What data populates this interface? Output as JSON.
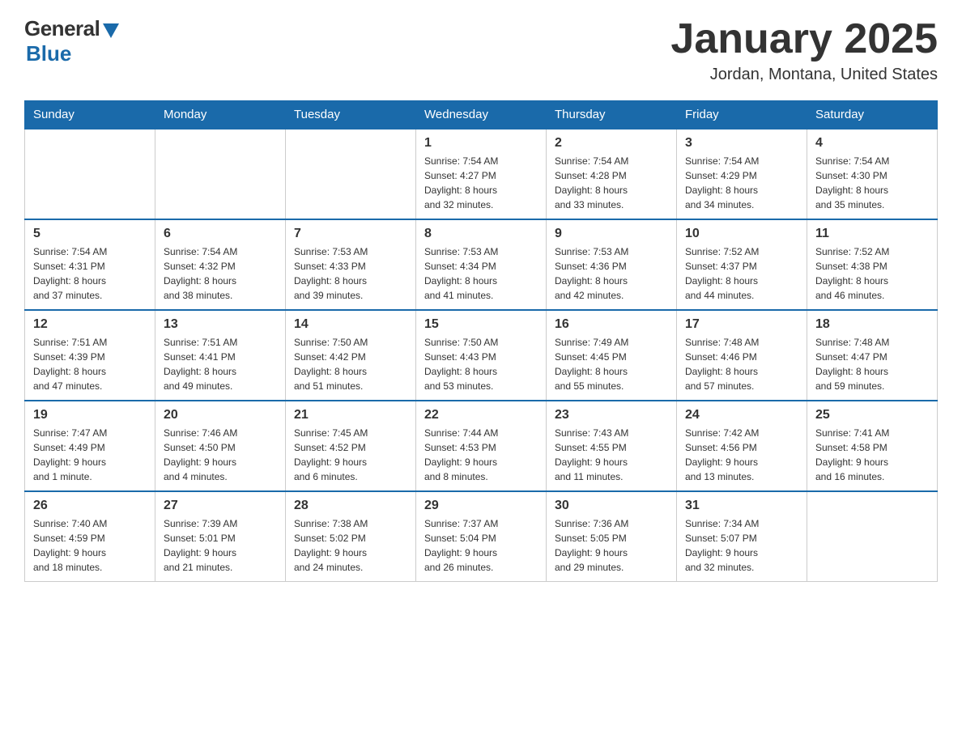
{
  "header": {
    "logo_general": "General",
    "logo_blue": "Blue",
    "title": "January 2025",
    "subtitle": "Jordan, Montana, United States"
  },
  "days_of_week": [
    "Sunday",
    "Monday",
    "Tuesday",
    "Wednesday",
    "Thursday",
    "Friday",
    "Saturday"
  ],
  "weeks": [
    {
      "days": [
        {
          "number": "",
          "info": ""
        },
        {
          "number": "",
          "info": ""
        },
        {
          "number": "",
          "info": ""
        },
        {
          "number": "1",
          "info": "Sunrise: 7:54 AM\nSunset: 4:27 PM\nDaylight: 8 hours\nand 32 minutes."
        },
        {
          "number": "2",
          "info": "Sunrise: 7:54 AM\nSunset: 4:28 PM\nDaylight: 8 hours\nand 33 minutes."
        },
        {
          "number": "3",
          "info": "Sunrise: 7:54 AM\nSunset: 4:29 PM\nDaylight: 8 hours\nand 34 minutes."
        },
        {
          "number": "4",
          "info": "Sunrise: 7:54 AM\nSunset: 4:30 PM\nDaylight: 8 hours\nand 35 minutes."
        }
      ]
    },
    {
      "days": [
        {
          "number": "5",
          "info": "Sunrise: 7:54 AM\nSunset: 4:31 PM\nDaylight: 8 hours\nand 37 minutes."
        },
        {
          "number": "6",
          "info": "Sunrise: 7:54 AM\nSunset: 4:32 PM\nDaylight: 8 hours\nand 38 minutes."
        },
        {
          "number": "7",
          "info": "Sunrise: 7:53 AM\nSunset: 4:33 PM\nDaylight: 8 hours\nand 39 minutes."
        },
        {
          "number": "8",
          "info": "Sunrise: 7:53 AM\nSunset: 4:34 PM\nDaylight: 8 hours\nand 41 minutes."
        },
        {
          "number": "9",
          "info": "Sunrise: 7:53 AM\nSunset: 4:36 PM\nDaylight: 8 hours\nand 42 minutes."
        },
        {
          "number": "10",
          "info": "Sunrise: 7:52 AM\nSunset: 4:37 PM\nDaylight: 8 hours\nand 44 minutes."
        },
        {
          "number": "11",
          "info": "Sunrise: 7:52 AM\nSunset: 4:38 PM\nDaylight: 8 hours\nand 46 minutes."
        }
      ]
    },
    {
      "days": [
        {
          "number": "12",
          "info": "Sunrise: 7:51 AM\nSunset: 4:39 PM\nDaylight: 8 hours\nand 47 minutes."
        },
        {
          "number": "13",
          "info": "Sunrise: 7:51 AM\nSunset: 4:41 PM\nDaylight: 8 hours\nand 49 minutes."
        },
        {
          "number": "14",
          "info": "Sunrise: 7:50 AM\nSunset: 4:42 PM\nDaylight: 8 hours\nand 51 minutes."
        },
        {
          "number": "15",
          "info": "Sunrise: 7:50 AM\nSunset: 4:43 PM\nDaylight: 8 hours\nand 53 minutes."
        },
        {
          "number": "16",
          "info": "Sunrise: 7:49 AM\nSunset: 4:45 PM\nDaylight: 8 hours\nand 55 minutes."
        },
        {
          "number": "17",
          "info": "Sunrise: 7:48 AM\nSunset: 4:46 PM\nDaylight: 8 hours\nand 57 minutes."
        },
        {
          "number": "18",
          "info": "Sunrise: 7:48 AM\nSunset: 4:47 PM\nDaylight: 8 hours\nand 59 minutes."
        }
      ]
    },
    {
      "days": [
        {
          "number": "19",
          "info": "Sunrise: 7:47 AM\nSunset: 4:49 PM\nDaylight: 9 hours\nand 1 minute."
        },
        {
          "number": "20",
          "info": "Sunrise: 7:46 AM\nSunset: 4:50 PM\nDaylight: 9 hours\nand 4 minutes."
        },
        {
          "number": "21",
          "info": "Sunrise: 7:45 AM\nSunset: 4:52 PM\nDaylight: 9 hours\nand 6 minutes."
        },
        {
          "number": "22",
          "info": "Sunrise: 7:44 AM\nSunset: 4:53 PM\nDaylight: 9 hours\nand 8 minutes."
        },
        {
          "number": "23",
          "info": "Sunrise: 7:43 AM\nSunset: 4:55 PM\nDaylight: 9 hours\nand 11 minutes."
        },
        {
          "number": "24",
          "info": "Sunrise: 7:42 AM\nSunset: 4:56 PM\nDaylight: 9 hours\nand 13 minutes."
        },
        {
          "number": "25",
          "info": "Sunrise: 7:41 AM\nSunset: 4:58 PM\nDaylight: 9 hours\nand 16 minutes."
        }
      ]
    },
    {
      "days": [
        {
          "number": "26",
          "info": "Sunrise: 7:40 AM\nSunset: 4:59 PM\nDaylight: 9 hours\nand 18 minutes."
        },
        {
          "number": "27",
          "info": "Sunrise: 7:39 AM\nSunset: 5:01 PM\nDaylight: 9 hours\nand 21 minutes."
        },
        {
          "number": "28",
          "info": "Sunrise: 7:38 AM\nSunset: 5:02 PM\nDaylight: 9 hours\nand 24 minutes."
        },
        {
          "number": "29",
          "info": "Sunrise: 7:37 AM\nSunset: 5:04 PM\nDaylight: 9 hours\nand 26 minutes."
        },
        {
          "number": "30",
          "info": "Sunrise: 7:36 AM\nSunset: 5:05 PM\nDaylight: 9 hours\nand 29 minutes."
        },
        {
          "number": "31",
          "info": "Sunrise: 7:34 AM\nSunset: 5:07 PM\nDaylight: 9 hours\nand 32 minutes."
        },
        {
          "number": "",
          "info": ""
        }
      ]
    }
  ]
}
